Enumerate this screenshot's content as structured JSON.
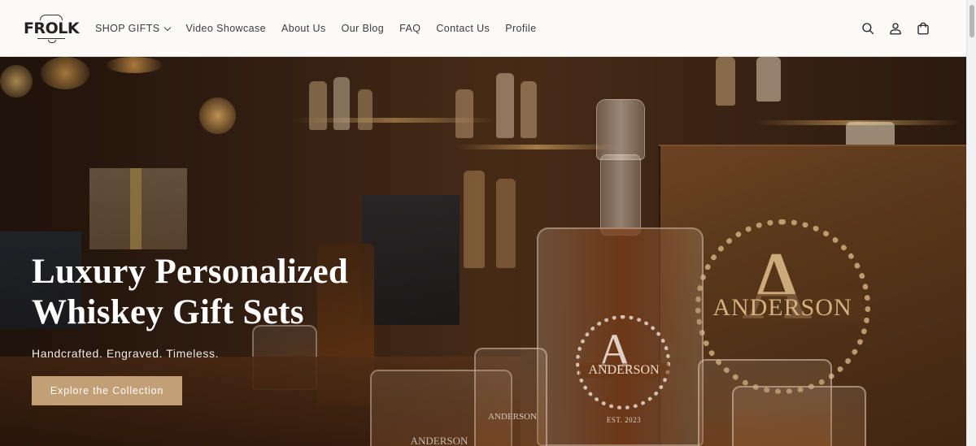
{
  "header": {
    "logo_text": "FROLK",
    "nav": [
      {
        "label": "SHOP GIFTS",
        "has_dropdown": true
      },
      {
        "label": "Video Showcase"
      },
      {
        "label": "About Us"
      },
      {
        "label": "Our Blog"
      },
      {
        "label": "FAQ"
      },
      {
        "label": "Contact Us"
      },
      {
        "label": "Profile"
      }
    ],
    "icons": [
      "search-icon",
      "account-icon",
      "cart-icon"
    ]
  },
  "hero": {
    "title_line1": "Luxury Personalized",
    "title_line2": "Whiskey Gift Sets",
    "subtitle": "Handcrafted. Engraved. Timeless.",
    "cta_label": "Explore the Collection",
    "engraving": {
      "letter": "A",
      "name": "ANDERSON",
      "est": "EST. 2023"
    }
  },
  "colors": {
    "cta_background": "#c29f75",
    "header_background": "#fbfaf7",
    "nav_text": "#3d3d3d"
  }
}
